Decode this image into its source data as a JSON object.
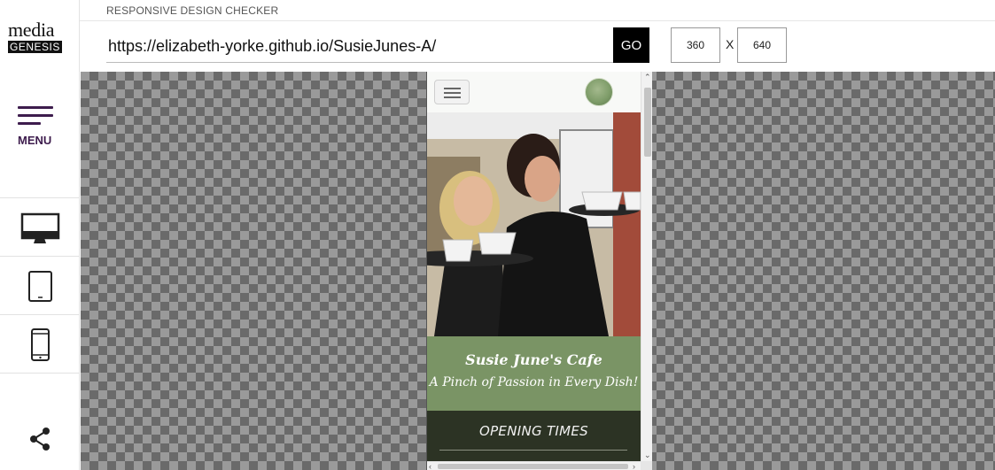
{
  "app": {
    "logo": {
      "line1": "media",
      "line2": "GENESIS"
    },
    "title": "RESPONSIVE DESIGN CHECKER",
    "menu_label": "MENU",
    "url_value": "https://elizabeth-yorke.github.io/SusieJunes-A/",
    "go_label": "GO",
    "width_value": "360",
    "height_value": "640",
    "dim_separator": "X"
  },
  "devices": [
    {
      "name": "desktop-icon"
    },
    {
      "name": "tablet-icon"
    },
    {
      "name": "phone-icon"
    }
  ],
  "site": {
    "title": "Susie June's Cafe",
    "subtitle": "A Pinch of Passion in Every Dish!",
    "section_heading": "OPENING TIMES"
  },
  "colors": {
    "brand_purple": "#3d1c4d",
    "site_green": "#7a9465",
    "site_dark": "#2c3324"
  }
}
